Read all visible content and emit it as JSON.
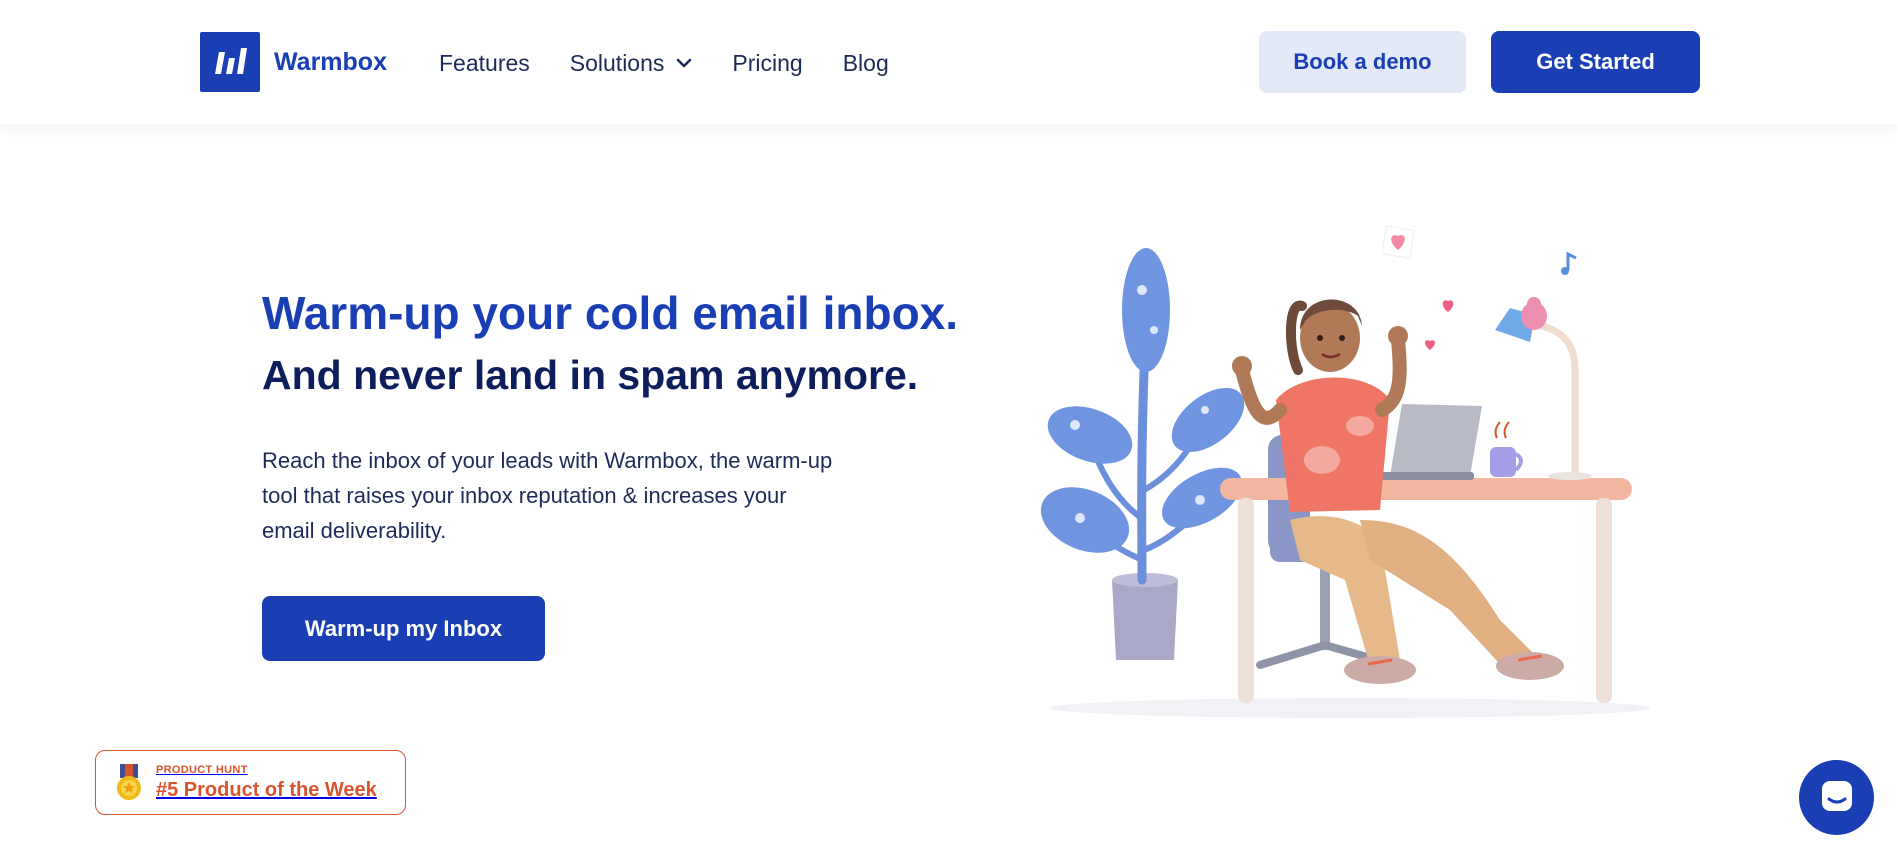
{
  "brand": {
    "name": "Warmbox",
    "logo_icon": "warmbox-logo-icon",
    "primary_color": "#1a3fb5",
    "dark_color": "#0e1e5c"
  },
  "nav": {
    "features": "Features",
    "solutions": "Solutions",
    "solutions_icon": "chevron-down-icon",
    "pricing": "Pricing",
    "blog": "Blog"
  },
  "header_actions": {
    "book_demo": "Book a demo",
    "get_started": "Get Started"
  },
  "hero": {
    "title": "Warm-up your cold email inbox.",
    "subtitle": "And never land in spam anymore.",
    "body": "Reach the inbox of your leads with Warmbox, the warm-up tool that raises your inbox reputation & increases your email deliverability.",
    "cta": "Warm-up my Inbox",
    "illustration": "woman-at-desk-illustration"
  },
  "badge": {
    "label_top": "PRODUCT HUNT",
    "label_main": "#5 Product of the Week",
    "icon": "medal-icon",
    "color": "#d9532c"
  },
  "chat": {
    "icon": "chat-icon"
  }
}
